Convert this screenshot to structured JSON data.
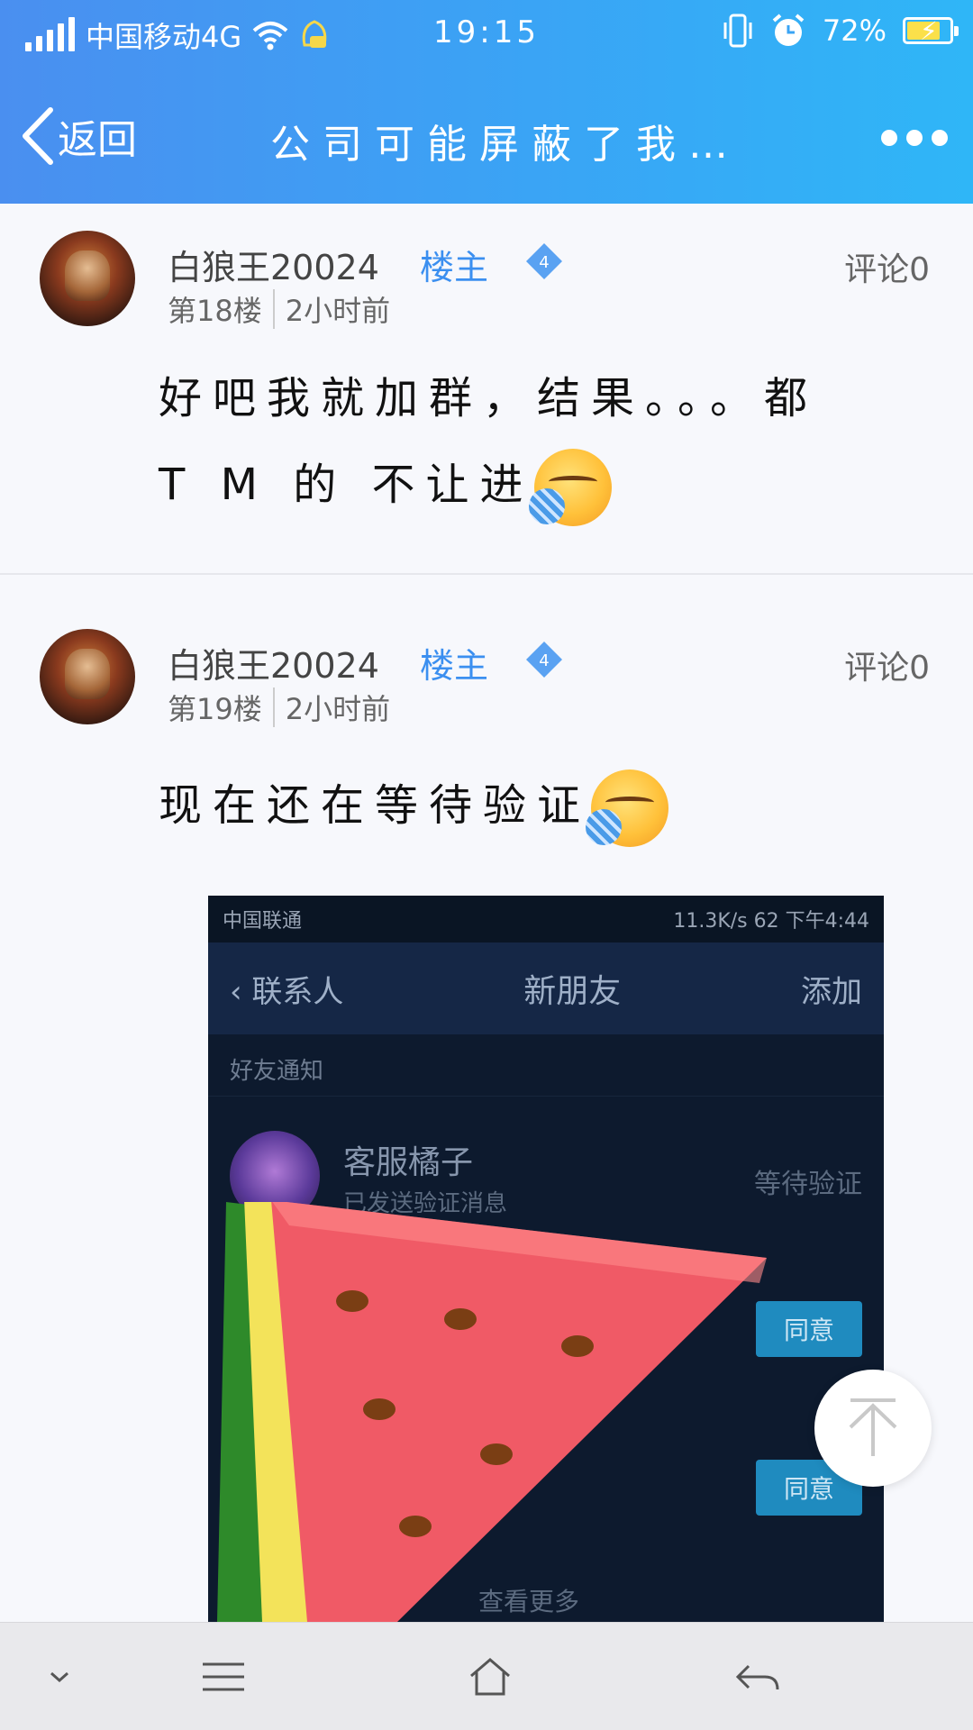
{
  "status_bar": {
    "carrier": "中国移动4G",
    "time": "19:15",
    "battery": "72%",
    "battery_level": 0.72
  },
  "nav": {
    "back_label": "返回",
    "title": "公司可能屏蔽了我…",
    "more_icon": "more-dots-icon"
  },
  "posts": [
    {
      "username": "白狼王20024",
      "tag": "楼主",
      "level": "4",
      "floor": "第18楼",
      "time": "2小时前",
      "comments": "评论0",
      "text_line1": "好吧我就加群，结果。。。都",
      "text_line2": "T M 的 不让进",
      "emoji": "angry-face-emoji"
    },
    {
      "username": "白狼王20024",
      "tag": "楼主",
      "level": "4",
      "floor": "第19楼",
      "time": "2小时前",
      "comments": "评论0",
      "text_line1": "现在还在等待验证",
      "emoji": "angry-face-emoji"
    }
  ],
  "embedded_screenshot": {
    "status_left": "中国联通",
    "status_right": "11.3K/s  62  下午4:44",
    "back_label": "联系人",
    "title": "新朋友",
    "add_label": "添加",
    "section": "好友通知",
    "row_name": "客服橘子",
    "row_sub": "已发送验证消息",
    "row_status": "等待验证",
    "accept_label_1": "同意",
    "accept_label_2": "同意",
    "more_label": "查看更多"
  },
  "bottom_bar": {
    "icons": [
      "chevron-down-icon",
      "menu-icon",
      "home-icon",
      "back-arrow-icon"
    ]
  },
  "colors": {
    "header_start": "#4a8ff0",
    "header_end": "#2fb6f7",
    "tag_blue": "#3b8ff0"
  }
}
